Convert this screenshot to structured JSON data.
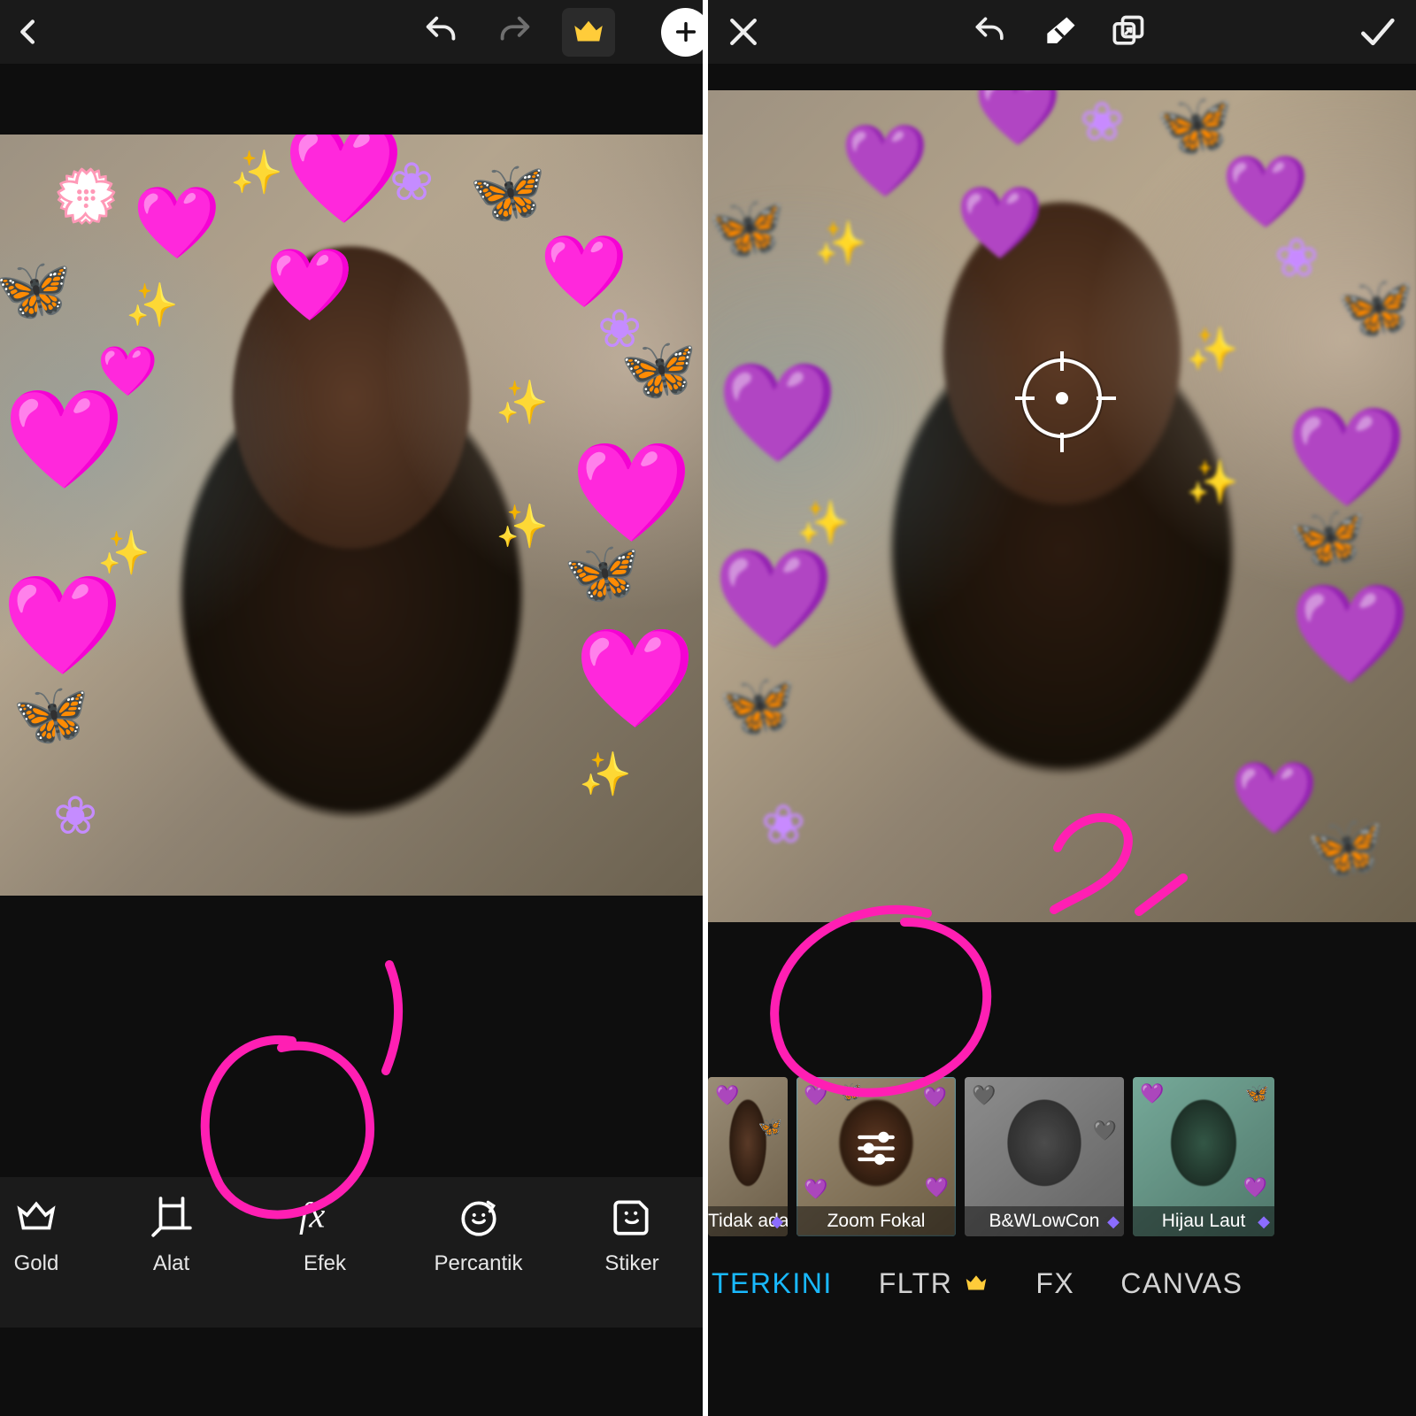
{
  "left": {
    "toolbar": {
      "back": "back",
      "undo": "undo",
      "redo": "redo",
      "premium_crown": "crown",
      "add_circle": "+"
    },
    "tools": [
      {
        "id": "gold",
        "label": "Gold"
      },
      {
        "id": "alat",
        "label": "Alat"
      },
      {
        "id": "efek",
        "label": "Efek"
      },
      {
        "id": "percantik",
        "label": "Percantik"
      },
      {
        "id": "stiker",
        "label": "Stiker"
      }
    ],
    "annotation": {
      "step_number": "1"
    }
  },
  "right": {
    "toolbar": {
      "close": "close",
      "undo": "undo",
      "eraser": "eraser",
      "compare": "compare",
      "apply": "apply"
    },
    "filters": [
      {
        "id": "none",
        "label": "Tidak ada",
        "selected": false
      },
      {
        "id": "zoom_fokal",
        "label": "Zoom Fokal",
        "selected": true
      },
      {
        "id": "bwlowcon",
        "label": "B&WLowCon",
        "selected": false
      },
      {
        "id": "hijau_laut",
        "label": "Hijau Laut",
        "selected": false
      }
    ],
    "categories": [
      {
        "id": "terkini",
        "label": "TERKINI",
        "active": true,
        "crown": false
      },
      {
        "id": "fltr",
        "label": "FLTR",
        "active": false,
        "crown": true
      },
      {
        "id": "fx",
        "label": "FX",
        "active": false,
        "crown": false
      },
      {
        "id": "canvas",
        "label": "CANVAS",
        "active": false,
        "crown": false
      }
    ],
    "annotation": {
      "step_number": "2"
    }
  }
}
